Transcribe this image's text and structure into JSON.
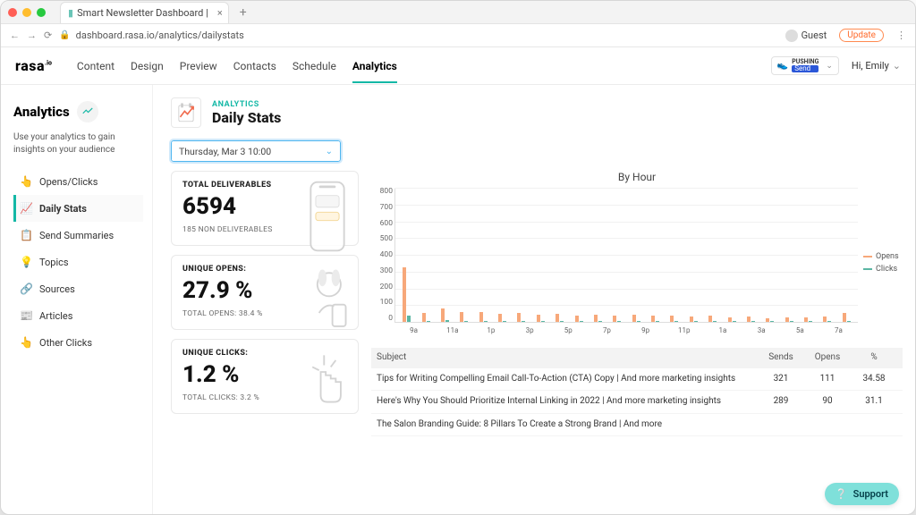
{
  "browser": {
    "tab_title": "Smart Newsletter Dashboard |",
    "url": "dashboard.rasa.io/analytics/dailystats",
    "guest_label": "Guest",
    "update_label": "Update"
  },
  "header": {
    "logo_text": "rasa",
    "logo_tm": ".io",
    "nav": [
      "Content",
      "Design",
      "Preview",
      "Contacts",
      "Schedule",
      "Analytics"
    ],
    "active_nav_index": 5,
    "org_badge_top": "PUSHING",
    "org_badge_bottom": "Send",
    "user_greeting": "Hi, Emily"
  },
  "sidebar": {
    "title": "Analytics",
    "subtitle": "Use your analytics to gain insights on your audience",
    "items": [
      {
        "icon": "👆",
        "label": "Opens/Clicks"
      },
      {
        "icon": "📈",
        "label": "Daily Stats"
      },
      {
        "icon": "📋",
        "label": "Send Summaries"
      },
      {
        "icon": "💡",
        "label": "Topics"
      },
      {
        "icon": "🔗",
        "label": "Sources"
      },
      {
        "icon": "📰",
        "label": "Articles"
      },
      {
        "icon": "👆",
        "label": "Other Clicks"
      }
    ],
    "active_index": 1
  },
  "page": {
    "crumb": "ANALYTICS",
    "title": "Daily Stats",
    "date_selected": "Thursday, Mar 3 10:00"
  },
  "stats": {
    "deliverables": {
      "label": "TOTAL DELIVERABLES",
      "value": "6594",
      "sub": "185 NON DELIVERABLES"
    },
    "opens": {
      "label": "UNIQUE OPENS:",
      "value": "27.9 %",
      "sub": "TOTAL OPENS: 38.4 %"
    },
    "clicks": {
      "label": "UNIQUE CLICKS:",
      "value": "1.2 %",
      "sub": "TOTAL CLICKS: 3.2 %"
    }
  },
  "chart_data": {
    "type": "bar",
    "title": "By Hour",
    "ylabel": "",
    "ylim": [
      0,
      800
    ],
    "yticks": [
      0,
      100,
      200,
      300,
      400,
      500,
      600,
      700,
      800
    ],
    "categories": [
      "9a",
      "10a",
      "11a",
      "12p",
      "1p",
      "2p",
      "3p",
      "4p",
      "5p",
      "6p",
      "7p",
      "8p",
      "9p",
      "10p",
      "11p",
      "12a",
      "1a",
      "2a",
      "3a",
      "4a",
      "5a",
      "6a",
      "7a",
      "8a"
    ],
    "xtick_labels": [
      "9a",
      "11a",
      "1p",
      "3p",
      "5p",
      "7p",
      "9p",
      "11p",
      "1a",
      "3a",
      "5a",
      "7a"
    ],
    "series": [
      {
        "name": "Opens",
        "color": "#f7a87a",
        "values": [
          330,
          55,
          80,
          60,
          60,
          50,
          55,
          45,
          50,
          40,
          45,
          35,
          45,
          35,
          40,
          30,
          35,
          25,
          30,
          20,
          25,
          25,
          30,
          55
        ]
      },
      {
        "name": "Clicks",
        "color": "#5bb6a3",
        "values": [
          40,
          8,
          10,
          8,
          8,
          6,
          7,
          6,
          6,
          5,
          5,
          4,
          6,
          4,
          5,
          4,
          4,
          3,
          4,
          3,
          3,
          3,
          4,
          6
        ]
      }
    ],
    "legend": [
      "Opens",
      "Clicks"
    ]
  },
  "table": {
    "headers": {
      "subject": "Subject",
      "sends": "Sends",
      "opens": "Opens",
      "pct": "%"
    },
    "rows": [
      {
        "subject": "Tips for Writing Compelling Email Call-To-Action (CTA) Copy | And more marketing insights",
        "sends": "321",
        "opens": "111",
        "pct": "34.58"
      },
      {
        "subject": "Here's Why You Should Prioritize Internal Linking in 2022 | And more marketing insights",
        "sends": "289",
        "opens": "90",
        "pct": "31.1"
      },
      {
        "subject": "The Salon Branding Guide: 8 Pillars To Create a Strong Brand | And more",
        "sends": "",
        "opens": "",
        "pct": ""
      }
    ]
  },
  "support_label": "Support"
}
